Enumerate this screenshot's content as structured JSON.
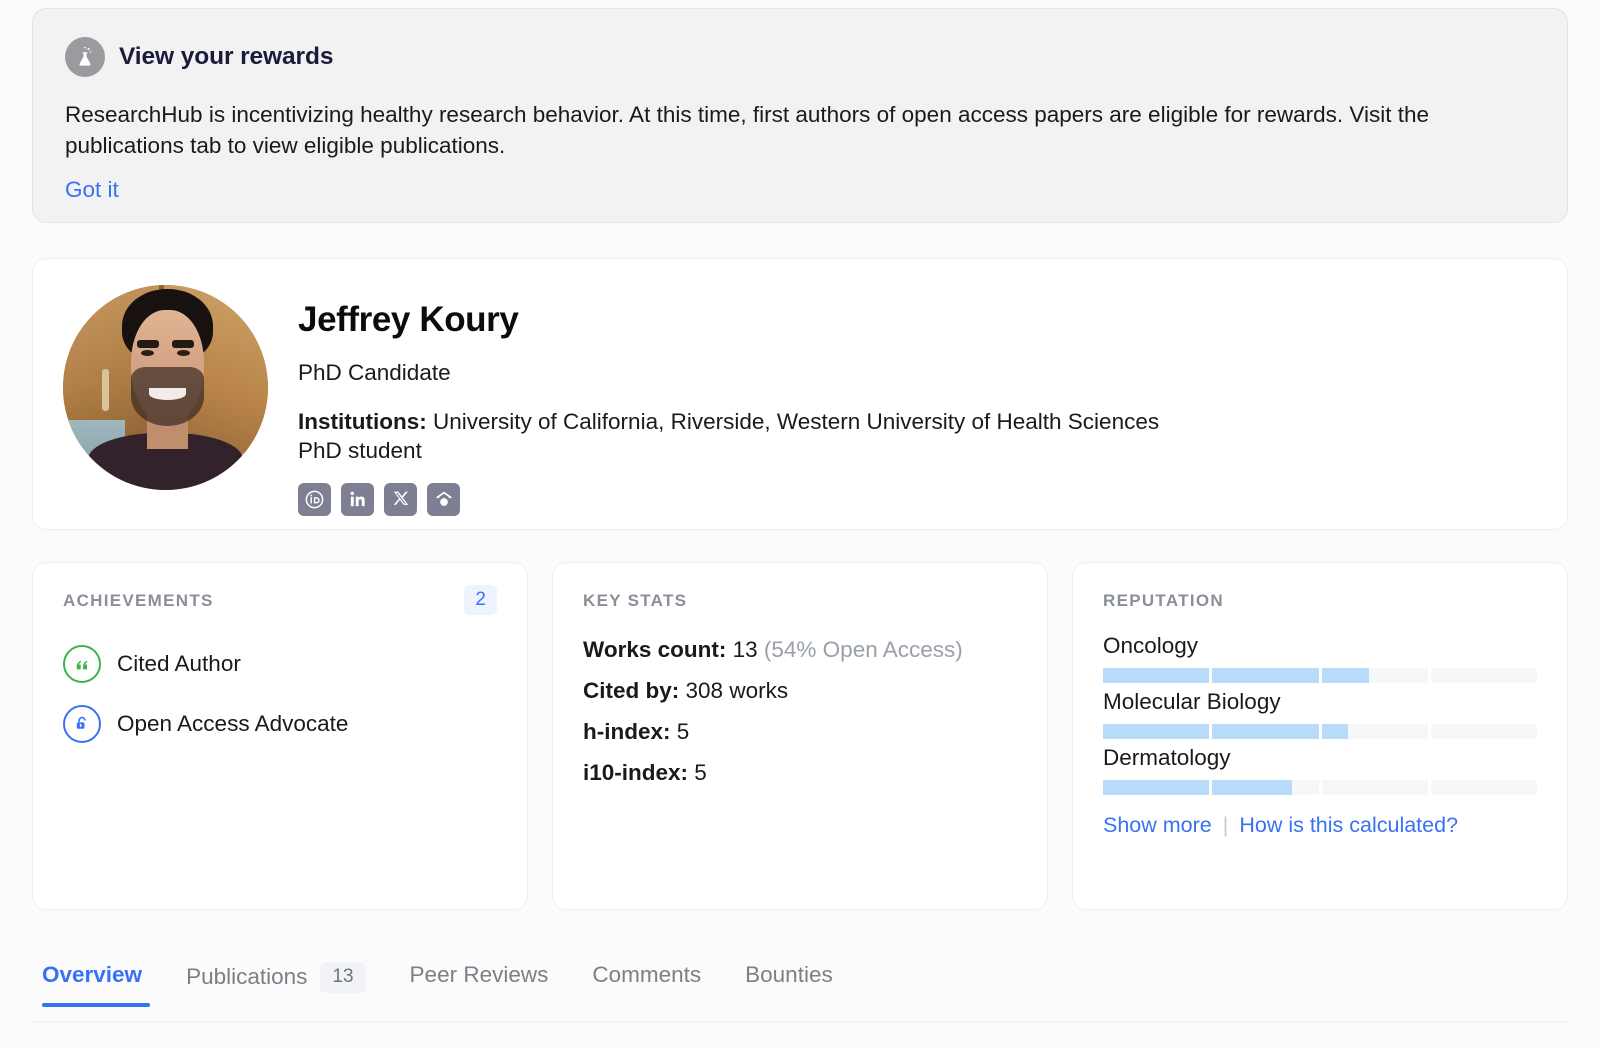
{
  "banner": {
    "icon": "flask-icon",
    "title": "View your rewards",
    "body": "ResearchHub is incentivizing healthy research behavior. At this time, first authors of open access papers are eligible for rewards. Visit the publications tab to view eligible publications.",
    "action_label": "Got it"
  },
  "profile": {
    "avatar_alt": "Jeffrey Koury profile photo",
    "name": "Jeffrey Koury",
    "headline": "PhD Candidate",
    "institutions_label": "Institutions:",
    "institutions_value": "University of California, Riverside, Western University of Health Sciences",
    "affiliation_line": "PhD student",
    "socials": [
      {
        "name": "orcid-icon",
        "glyph": "iD"
      },
      {
        "name": "linkedin-icon",
        "glyph": "in"
      },
      {
        "name": "x-twitter-icon",
        "glyph": "X"
      },
      {
        "name": "researchhub-icon",
        "glyph": "RH"
      }
    ]
  },
  "achievements": {
    "label": "ACHIEVEMENTS",
    "count": "2",
    "items": [
      {
        "label": "Cited Author",
        "icon": "quote-icon",
        "color": "#3bb54a"
      },
      {
        "label": "Open Access Advocate",
        "icon": "open-lock-icon",
        "color": "#3971f5"
      }
    ]
  },
  "key_stats": {
    "label": "KEY STATS",
    "rows": [
      {
        "label": "Works count:",
        "value": "13",
        "note": "(54% Open Access)"
      },
      {
        "label": "Cited by:",
        "value": "308 works",
        "note": ""
      },
      {
        "label": "h-index:",
        "value": "5",
        "note": ""
      },
      {
        "label": "i10-index:",
        "value": "5",
        "note": ""
      }
    ]
  },
  "reputation": {
    "label": "REPUTATION",
    "segments_per_bar": 4,
    "items": [
      {
        "name": "Oncology",
        "segments": [
          100,
          100,
          45,
          0
        ]
      },
      {
        "name": "Molecular Biology",
        "segments": [
          100,
          100,
          25,
          0
        ]
      },
      {
        "name": "Dermatology",
        "segments": [
          100,
          75,
          0,
          0
        ]
      }
    ],
    "show_more_label": "Show more",
    "separator": "|",
    "how_calculated_label": "How is this calculated?"
  },
  "tabs": [
    {
      "label": "Overview",
      "badge": "",
      "active": true
    },
    {
      "label": "Publications",
      "badge": "13",
      "active": false
    },
    {
      "label": "Peer Reviews",
      "badge": "",
      "active": false
    },
    {
      "label": "Comments",
      "badge": "",
      "active": false
    },
    {
      "label": "Bounties",
      "badge": "",
      "active": false
    }
  ],
  "colors": {
    "accent": "#3971f5",
    "page_bg": "#fbfbfc",
    "card_bg": "#ffffff",
    "banner_bg": "#f2f2f3",
    "rep_fill": "#b9dbfb",
    "rep_track": "#f6f7f8",
    "muted_text": "#8a8f98",
    "green": "#3bb54a"
  }
}
